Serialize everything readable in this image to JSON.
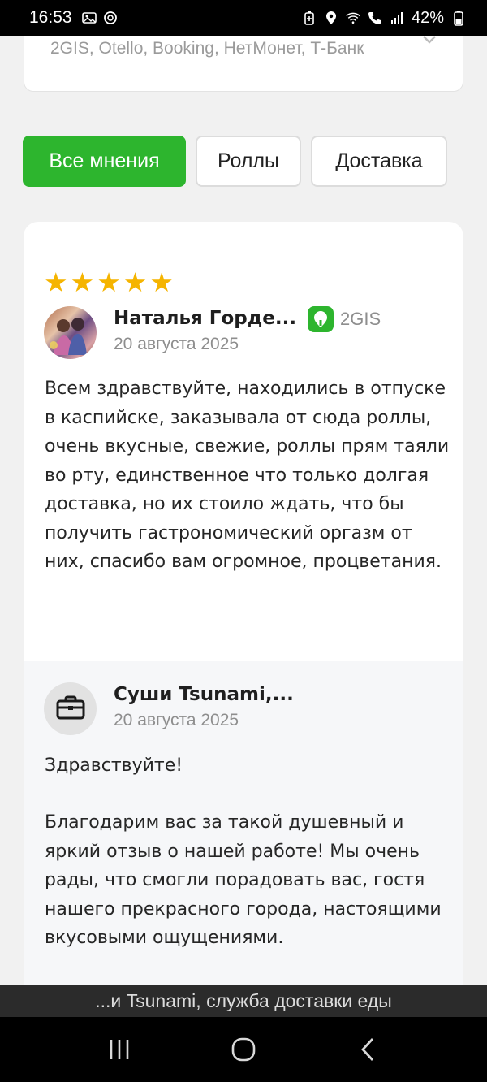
{
  "status_bar": {
    "time": "16:53",
    "battery": "42%",
    "icons_left": [
      "gallery-notification-icon",
      "chat-notification-icon"
    ],
    "icons_right": [
      "battery-saver-icon",
      "location-icon",
      "wifi-icon",
      "call-icon",
      "signal-icon",
      "battery-icon"
    ]
  },
  "sources": {
    "text": "2GIS, Otello, Booking, НетМонет, Т-Банк",
    "icon": "chevron-down-icon"
  },
  "filters": [
    {
      "label": "Все мнения",
      "active": true
    },
    {
      "label": "Роллы",
      "active": false
    },
    {
      "label": "Доставка",
      "active": false
    }
  ],
  "review": {
    "rating": 5,
    "author": "Наталья Горде...",
    "date": "20 августа 2025",
    "source": "2GIS",
    "text": "Всем здравствуйте, находились в отпуске в каспийске, заказывала от сюда роллы, очень вкусные, свежие, роллы прям таяли во рту, единственное что только долгая доставка, но их стоило ждать, что бы получить гастрономический оргазм от них, спасибо вам огромное, процветания."
  },
  "reply": {
    "author": "Суши Tsunami,...",
    "date": "20 августа 2025",
    "greeting": "Здравствуйте!",
    "text": "Благодарим вас за такой душевный и яркий отзыв о нашей работе! Мы очень рады, что смогли порадовать вас, гостя нашего прекрасного города, настоящими вкусовыми ощущениями."
  },
  "bottom_bar": {
    "title": "...и Tsunami, служба доставки еды"
  },
  "colors": {
    "accent": "#2db52e",
    "star": "#f5b400"
  }
}
